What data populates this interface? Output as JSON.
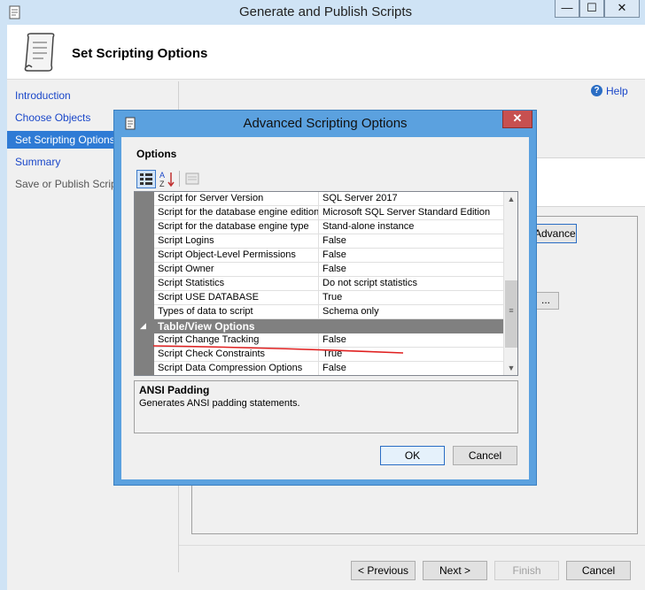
{
  "wizard": {
    "title": "Generate and Publish Scripts",
    "caption_buttons": {
      "minimize": "—",
      "maximize": "☐",
      "close": "✕"
    },
    "header_title": "Set Scripting Options",
    "help_label": "Help",
    "nav": [
      {
        "label": "Introduction",
        "state": "link"
      },
      {
        "label": "Choose Objects",
        "state": "link"
      },
      {
        "label": "Set Scripting Options",
        "state": "active"
      },
      {
        "label": "Summary",
        "state": "link"
      },
      {
        "label": "Save or Publish Scripts",
        "state": "disabled"
      }
    ],
    "background_advanced_btn": "Advanced",
    "background_dots_btn": "...",
    "buttons": {
      "previous": "< Previous",
      "next": "Next >",
      "finish": "Finish",
      "cancel": "Cancel"
    }
  },
  "dialog": {
    "title": "Advanced Scripting Options",
    "close": "✕",
    "options_label": "Options",
    "grid_rows": [
      {
        "name": "Script for Server Version",
        "value": "SQL Server 2017"
      },
      {
        "name": "Script for the database engine edition",
        "value": "Microsoft SQL Server Standard Edition"
      },
      {
        "name": "Script for the database engine type",
        "value": "Stand-alone instance"
      },
      {
        "name": "Script Logins",
        "value": "False"
      },
      {
        "name": "Script Object-Level Permissions",
        "value": "False"
      },
      {
        "name": "Script Owner",
        "value": "False"
      },
      {
        "name": "Script Statistics",
        "value": "Do not script statistics"
      },
      {
        "name": "Script USE DATABASE",
        "value": "True"
      },
      {
        "name": "Types of data to script",
        "value": "Schema only"
      }
    ],
    "category": {
      "label": "Table/View Options",
      "expander": "◢"
    },
    "category_rows": [
      {
        "name": "Script Change Tracking",
        "value": "False"
      },
      {
        "name": "Script Check Constraints",
        "value": "True"
      },
      {
        "name": "Script Data Compression Options",
        "value": "False"
      }
    ],
    "scroll": {
      "up": "▲",
      "down": "▼",
      "grip": "≡"
    },
    "description": {
      "title": "ANSI Padding",
      "text": "Generates ANSI padding statements."
    },
    "ok": "OK",
    "cancel": "Cancel",
    "annotation_color": "#e02020"
  }
}
